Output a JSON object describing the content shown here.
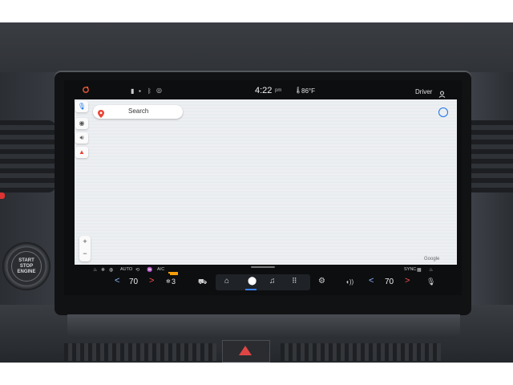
{
  "start_button": {
    "line1": "START",
    "line2": "STOP",
    "line3": "ENGINE"
  },
  "status_bar": {
    "time": "4:22",
    "ampm": "pm",
    "outside_temp": "86°F",
    "profile": "Driver"
  },
  "map": {
    "search_placeholder": "Search",
    "zoom_in": "+",
    "zoom_out": "−",
    "attribution": "Google"
  },
  "climate": {
    "auto_label": "AUTO",
    "ac_label": "A/C",
    "sync_label": "SYNC",
    "driver_temp": "70",
    "passenger_temp": "70",
    "fan_speed": "3",
    "decrease_symbol": "<",
    "increase_symbol": ">"
  },
  "dock": {
    "items": [
      "home",
      "maps",
      "music",
      "apps"
    ],
    "active": "maps"
  },
  "colors": {
    "accent_blue": "#3b82f6",
    "temp_up_red": "#ff4d4d",
    "temp_down_blue": "#8fb5ff",
    "map_bg": "#eef0f3"
  }
}
